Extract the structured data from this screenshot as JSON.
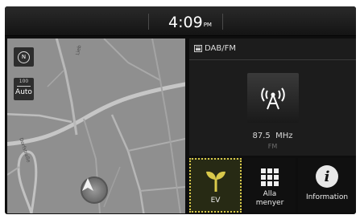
{
  "status_bar": {
    "time": "4:09",
    "ampm": "PM"
  },
  "map": {
    "compass_label": "N",
    "scale_value": "100",
    "scale_mode": "Auto",
    "street_labels": [
      "Dorfstraße",
      "Lieb"
    ],
    "vehicle_icon": "navigation-arrow-icon"
  },
  "media": {
    "source_icon": "radio-source-icon",
    "source_label": "DAB/FM",
    "station_icon": "broadcast-antenna-icon",
    "frequency": "87.5  MHz",
    "band": "FM"
  },
  "buttons": [
    {
      "label": "EV",
      "icon": "leaf-sprout-icon",
      "accent": "#d9c94a"
    },
    {
      "label": "Alla\nmenyer",
      "icon": "grid-menu-icon"
    },
    {
      "label": "Information",
      "icon": "info-icon"
    }
  ]
}
